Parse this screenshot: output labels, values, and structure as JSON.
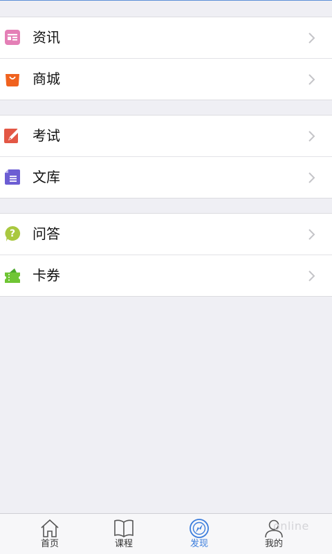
{
  "groups": [
    {
      "items": [
        {
          "label": "资讯",
          "icon": "news-icon",
          "color": "#e47fb6"
        },
        {
          "label": "商城",
          "icon": "shopping-bag-icon",
          "color": "#f0621e"
        }
      ]
    },
    {
      "items": [
        {
          "label": "考试",
          "icon": "exam-pencil-icon",
          "color": "#e35745"
        },
        {
          "label": "文库",
          "icon": "document-library-icon",
          "color": "#6c5dd3"
        }
      ]
    },
    {
      "items": [
        {
          "label": "问答",
          "icon": "question-bubble-icon",
          "color": "#a9c83f"
        },
        {
          "label": "卡券",
          "icon": "ticket-icon",
          "color": "#6fc534"
        }
      ]
    }
  ],
  "tabbar": {
    "tabs": [
      {
        "label": "首页",
        "icon": "home-icon",
        "active": false
      },
      {
        "label": "课程",
        "icon": "book-icon",
        "active": false
      },
      {
        "label": "发现",
        "icon": "compass-icon",
        "active": true
      },
      {
        "label": "我的",
        "icon": "user-icon",
        "active": false
      }
    ],
    "active_color": "#3b7ddd"
  },
  "watermark": "online"
}
